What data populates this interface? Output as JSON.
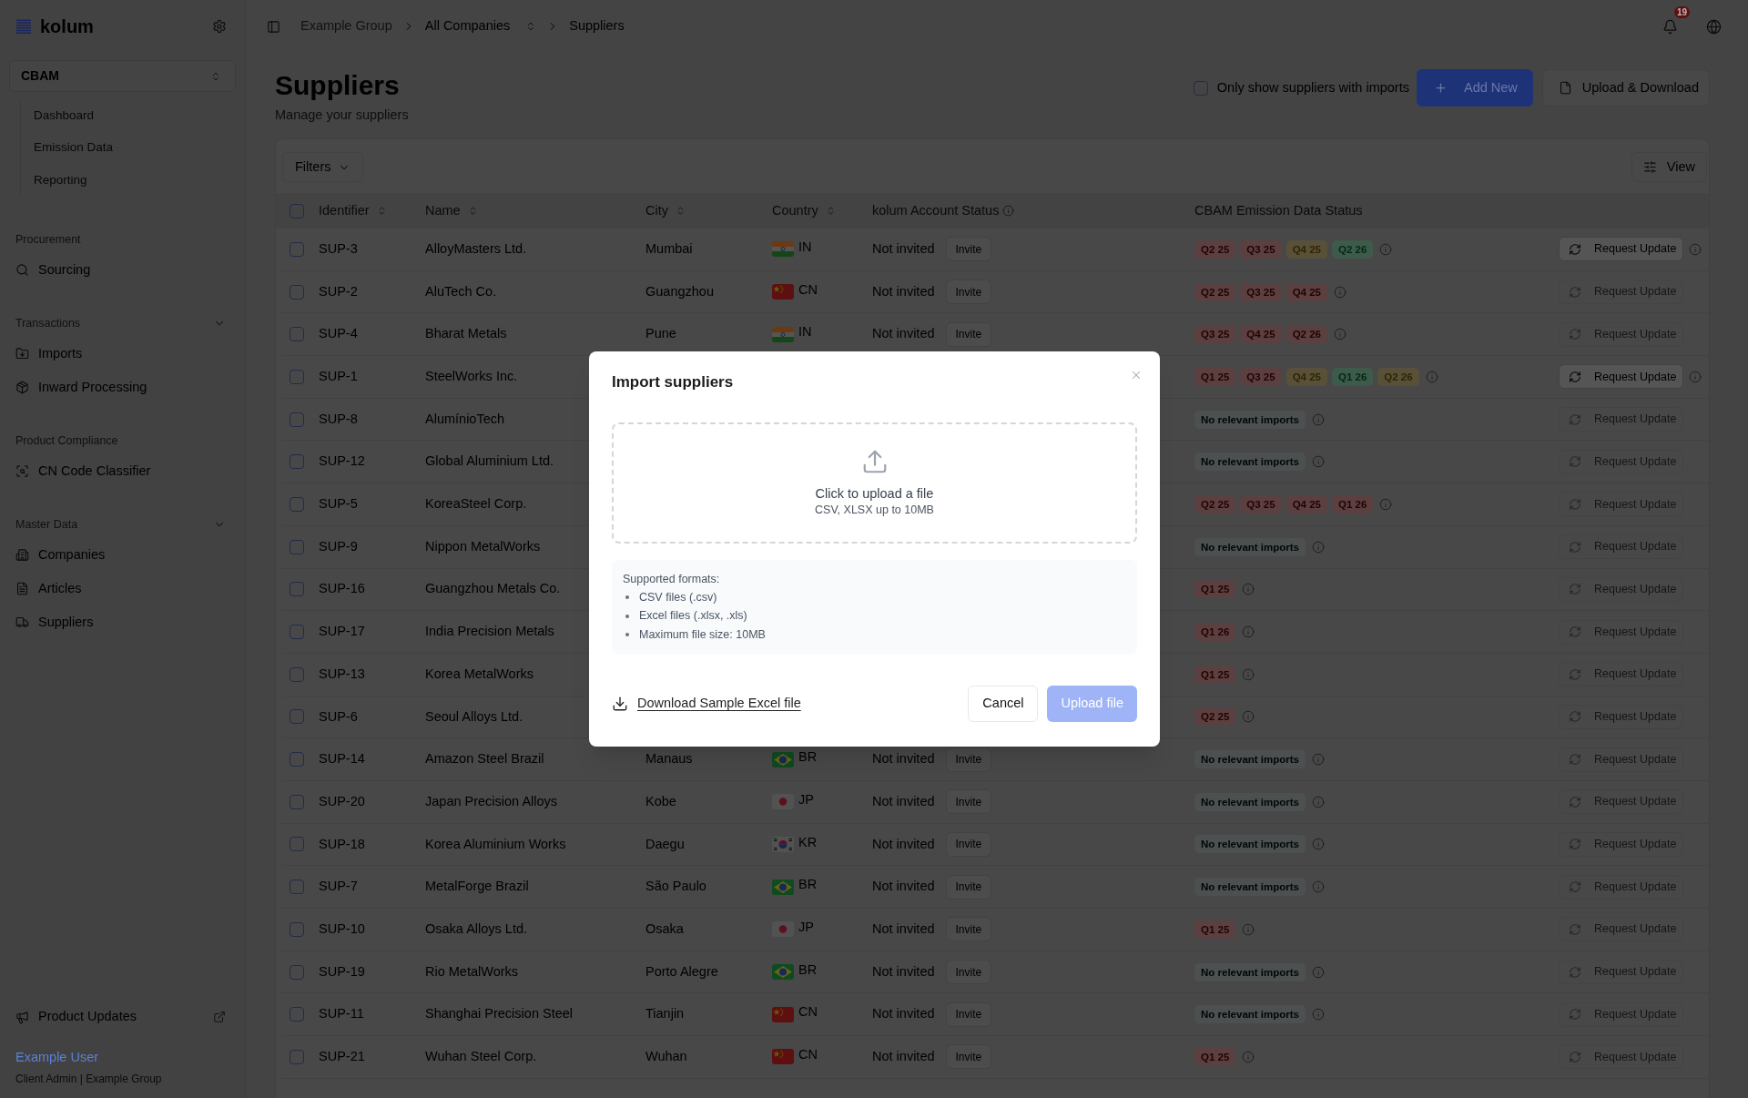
{
  "sidebar": {
    "logo": "kolum",
    "module": "CBAM",
    "module_items": [
      "Dashboard",
      "Emission Data",
      "Reporting"
    ],
    "sections": [
      {
        "label": "Procurement",
        "items": [
          "Sourcing"
        ]
      },
      {
        "label": "Transactions",
        "expanded": true,
        "items": [
          "Imports",
          "Inward Processing"
        ]
      },
      {
        "label": "Product Compliance",
        "items": [
          "CN Code Classifier"
        ]
      },
      {
        "label": "Master Data",
        "expanded": true,
        "items": [
          "Companies",
          "Articles",
          "Suppliers"
        ]
      }
    ],
    "footer": "Product Updates",
    "user": {
      "name": "Example User",
      "role": "Client Admin | Example Group"
    }
  },
  "header": {
    "breadcrumb": [
      {
        "label": "Example Group",
        "kind": "link"
      },
      {
        "label": "All Companies",
        "kind": "switcher"
      },
      {
        "label": "Suppliers",
        "kind": "current"
      }
    ],
    "notifications": "19"
  },
  "page": {
    "title": "Suppliers",
    "subtitle": "Manage your suppliers",
    "imports_filter": {
      "label": "Only show suppliers with imports",
      "checked": false
    },
    "actions": [
      {
        "label": "Add New",
        "kind": "primary"
      },
      {
        "label": "Upload & Download",
        "kind": "outline"
      }
    ]
  },
  "table": {
    "toolbar": {
      "filters": "Filters",
      "view": "View"
    },
    "select_all": {
      "checked": false
    },
    "columns": [
      {
        "label": "Identifier",
        "sortable": true,
        "info": false
      },
      {
        "label": "Name",
        "sortable": true,
        "info": false
      },
      {
        "label": "City",
        "sortable": true,
        "info": false
      },
      {
        "label": "Country",
        "sortable": true,
        "info": false
      },
      {
        "label": "kolum Account Status",
        "sortable": false,
        "info": true
      },
      {
        "label": "CBAM Emission Data Status",
        "sortable": false,
        "info": false
      }
    ],
    "rows": [
      {
        "checked": false,
        "identifier": "SUP-3",
        "name": "AlloyMasters Ltd.",
        "city": "Mumbai",
        "country": "IN",
        "account_status": "Not invited",
        "invite": "Invite",
        "badges": [
          {
            "label": "Q2 25",
            "color": "#5a4040"
          },
          {
            "label": "Q3 25",
            "color": "#5a4040"
          },
          {
            "label": "Q4 25",
            "color": "#585038"
          },
          {
            "label": "Q2 26",
            "color": "#3e5a4a"
          }
        ],
        "request": {
          "label": "Request Update",
          "disabled": false
        }
      },
      {
        "checked": false,
        "identifier": "SUP-2",
        "name": "AluTech Co.",
        "city": "Guangzhou",
        "country": "CN",
        "account_status": "Not invited",
        "invite": "Invite",
        "badges": [
          {
            "label": "Q2 25",
            "color": "#5a4040"
          },
          {
            "label": "Q3 25",
            "color": "#5a4040"
          },
          {
            "label": "Q4 25",
            "color": "#5a4040"
          }
        ],
        "request": {
          "label": "Request Update",
          "disabled": true
        }
      },
      {
        "checked": false,
        "identifier": "SUP-4",
        "name": "Bharat Metals",
        "city": "Pune",
        "country": "IN",
        "account_status": "Not invited",
        "invite": "Invite",
        "badges": [
          {
            "label": "Q3 25",
            "color": "#5a4040"
          },
          {
            "label": "Q4 25",
            "color": "#5a4040"
          },
          {
            "label": "Q2 26",
            "color": "#5a4040"
          }
        ],
        "request": {
          "label": "Request Update",
          "disabled": true
        }
      },
      {
        "checked": false,
        "identifier": "SUP-1",
        "name": "SteelWorks Inc.",
        "badges": [
          {
            "label": "Q1 25",
            "color": "#5a4040"
          },
          {
            "label": "Q3 25",
            "color": "#5a4040"
          },
          {
            "label": "Q4 25",
            "color": "#585038"
          },
          {
            "label": "Q1 26",
            "color": "#3e5a4a"
          },
          {
            "label": "Q2 26",
            "color": "#585038"
          }
        ],
        "request": {
          "label": "Request Update",
          "disabled": false
        }
      },
      {
        "checked": false,
        "identifier": "SUP-8",
        "name": "AlumínioTech",
        "badges": [
          {
            "label": "No relevant imports",
            "color": "#4c5050"
          }
        ],
        "request": {
          "label": "Request Update",
          "disabled": true
        }
      },
      {
        "checked": false,
        "identifier": "SUP-12",
        "name": "Global Aluminium Ltd.",
        "badges": [
          {
            "label": "No relevant imports",
            "color": "#4c5050"
          }
        ],
        "request": {
          "label": "Request Update",
          "disabled": true
        }
      },
      {
        "checked": false,
        "identifier": "SUP-5",
        "name": "KoreaSteel Corp.",
        "badges": [
          {
            "label": "Q2 25",
            "color": "#5a4040"
          },
          {
            "label": "Q3 25",
            "color": "#5a4040"
          },
          {
            "label": "Q4 25",
            "color": "#5a4040"
          },
          {
            "label": "Q1 26",
            "color": "#5a4040"
          }
        ],
        "request": {
          "label": "Request Update",
          "disabled": true
        }
      },
      {
        "checked": false,
        "identifier": "SUP-9",
        "name": "Nippon MetalWorks",
        "badges": [
          {
            "label": "No relevant imports",
            "color": "#4c5050"
          }
        ],
        "request": {
          "label": "Request Update",
          "disabled": true
        }
      },
      {
        "checked": false,
        "identifier": "SUP-16",
        "name": "Guangzhou Metals Co.",
        "badges": [
          {
            "label": "Q1 25",
            "color": "#5a4040"
          }
        ],
        "request": {
          "label": "Request Update",
          "disabled": true
        }
      },
      {
        "checked": false,
        "identifier": "SUP-17",
        "name": "India Precision Metals",
        "badges": [
          {
            "label": "Q1 26",
            "color": "#5a4040"
          }
        ],
        "request": {
          "label": "Request Update",
          "disabled": true
        }
      },
      {
        "checked": false,
        "identifier": "SUP-13",
        "name": "Korea MetalWorks",
        "badges": [
          {
            "label": "Q1 25",
            "color": "#5a4040"
          }
        ],
        "request": {
          "label": "Request Update",
          "disabled": true
        }
      },
      {
        "checked": false,
        "identifier": "SUP-6",
        "name": "Seoul Alloys Ltd.",
        "badges": [
          {
            "label": "Q2 25",
            "color": "#5a4040"
          }
        ],
        "request": {
          "label": "Request Update",
          "disabled": true
        }
      },
      {
        "checked": false,
        "identifier": "SUP-14",
        "name": "Amazon Steel Brazil",
        "city": "Manaus",
        "country": "BR",
        "account_status": "Not invited",
        "invite": "Invite",
        "badges": [
          {
            "label": "No relevant imports",
            "color": "#4c5050"
          }
        ],
        "request": {
          "label": "Request Update",
          "disabled": true
        }
      },
      {
        "checked": false,
        "identifier": "SUP-20",
        "name": "Japan Precision Alloys",
        "city": "Kobe",
        "country": "JP",
        "account_status": "Not invited",
        "invite": "Invite",
        "badges": [
          {
            "label": "No relevant imports",
            "color": "#4c5050"
          }
        ],
        "request": {
          "label": "Request Update",
          "disabled": true
        }
      },
      {
        "checked": false,
        "identifier": "SUP-18",
        "name": "Korea Aluminium Works",
        "city": "Daegu",
        "country": "KR",
        "account_status": "Not invited",
        "invite": "Invite",
        "badges": [
          {
            "label": "No relevant imports",
            "color": "#4c5050"
          }
        ],
        "request": {
          "label": "Request Update",
          "disabled": true
        }
      },
      {
        "checked": false,
        "identifier": "SUP-7",
        "name": "MetalForge Brazil",
        "city": "São Paulo",
        "country": "BR",
        "account_status": "Not invited",
        "invite": "Invite",
        "badges": [
          {
            "label": "No relevant imports",
            "color": "#4c5050"
          }
        ],
        "request": {
          "label": "Request Update",
          "disabled": true
        }
      },
      {
        "checked": false,
        "identifier": "SUP-10",
        "name": "Osaka Alloys Ltd.",
        "city": "Osaka",
        "country": "JP",
        "account_status": "Not invited",
        "invite": "Invite",
        "badges": [
          {
            "label": "Q1 25",
            "color": "#5a4040"
          }
        ],
        "request": {
          "label": "Request Update",
          "disabled": true
        }
      },
      {
        "checked": false,
        "identifier": "SUP-19",
        "name": "Rio MetalWorks",
        "city": "Porto Alegre",
        "country": "BR",
        "account_status": "Not invited",
        "invite": "Invite",
        "badges": [
          {
            "label": "No relevant imports",
            "color": "#4c5050"
          }
        ],
        "request": {
          "label": "Request Update",
          "disabled": true
        }
      },
      {
        "checked": false,
        "identifier": "SUP-11",
        "name": "Shanghai Precision Steel",
        "city": "Tianjin",
        "country": "CN",
        "account_status": "Not invited",
        "invite": "Invite",
        "badges": [
          {
            "label": "No relevant imports",
            "color": "#4c5050"
          }
        ],
        "request": {
          "label": "Request Update",
          "disabled": true
        }
      },
      {
        "checked": false,
        "identifier": "SUP-21",
        "name": "Wuhan Steel Corp.",
        "city": "Wuhan",
        "country": "CN",
        "account_status": "Not invited",
        "invite": "Invite",
        "badges": [
          {
            "label": "Q1 25",
            "color": "#5a4040"
          }
        ],
        "request": {
          "label": "Request Update",
          "disabled": true
        }
      }
    ]
  },
  "modal": {
    "title": "Import suppliers",
    "dropzone": {
      "title": "Click to upload a file",
      "hint": "CSV, XLSX up to 10MB"
    },
    "formats": {
      "heading": "Supported formats:",
      "items": [
        "CSV files (.csv)",
        "Excel files (.xlsx, .xls)",
        "Maximum file size: 10MB"
      ]
    },
    "sample_link": "Download Sample Excel file",
    "buttons": [
      {
        "label": "Cancel",
        "kind": "secondary",
        "disabled": false
      },
      {
        "label": "Upload file",
        "kind": "primary",
        "disabled": true
      }
    ]
  }
}
